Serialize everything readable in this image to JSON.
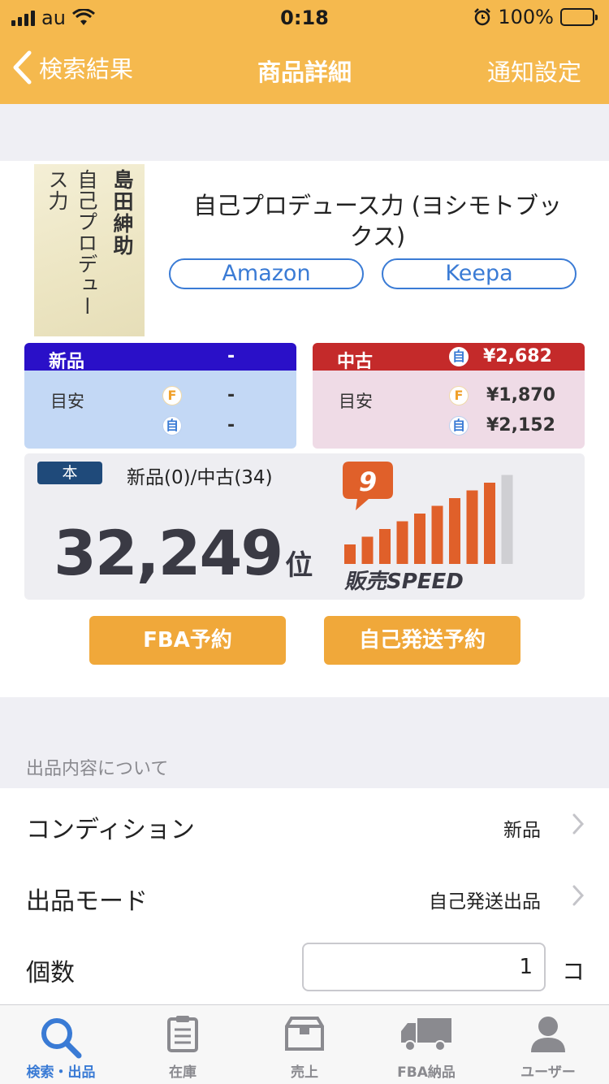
{
  "status_bar": {
    "carrier": "au",
    "time": "0:18",
    "battery": "100%"
  },
  "nav": {
    "back_label": "検索結果",
    "title": "商品詳細",
    "right_label": "通知設定"
  },
  "product": {
    "cover_author": "島田紳助",
    "cover_title": "自己プロデュース力",
    "title": "自己プロデュース力 (ヨシモトブックス)",
    "links": [
      "Amazon",
      "Keepa"
    ]
  },
  "new_price": {
    "label": "新品",
    "value": "-",
    "guide_label": "目安",
    "fba_badge": "F",
    "self_badge": "自",
    "fba": "-",
    "self": "-"
  },
  "used_price": {
    "label": "中古",
    "head_badge": "自",
    "value": "¥2,682",
    "guide_label": "目安",
    "fba_badge": "F",
    "self_badge": "自",
    "fba": "¥1,870",
    "self": "¥2,152"
  },
  "ranking": {
    "category": "本",
    "counts": "新品(0)/中古(34)",
    "rank": "32,249",
    "rank_unit": "位"
  },
  "sales_speed": {
    "level": "9",
    "label": "販売SPEED",
    "max": 10
  },
  "actions": {
    "fba_reserve": "FBA予約",
    "self_reserve": "自己発送予約"
  },
  "listing": {
    "section_label": "出品内容について",
    "condition_label": "コンディション",
    "condition_value": "新品",
    "mode_label": "出品モード",
    "mode_value": "自己発送出品",
    "qty_label": "個数",
    "qty_value": "1",
    "qty_unit": "コ"
  },
  "tabs": [
    {
      "label": "検索・出品",
      "icon": "search-icon",
      "active": true
    },
    {
      "label": "在庫",
      "icon": "clipboard-icon"
    },
    {
      "label": "売上",
      "icon": "box-icon"
    },
    {
      "label": "FBA納品",
      "icon": "truck-icon"
    },
    {
      "label": "ユーザー",
      "icon": "user-icon"
    }
  ],
  "colors": {
    "accent": "#f5b94e",
    "new_header": "#2a10c8",
    "new_body": "#c3d8f5",
    "used_header": "#c42a2a",
    "used_body": "#efdbe6",
    "button": "#f0a83a",
    "speed_bar": "#e0602a",
    "link": "#3a7bd5"
  }
}
